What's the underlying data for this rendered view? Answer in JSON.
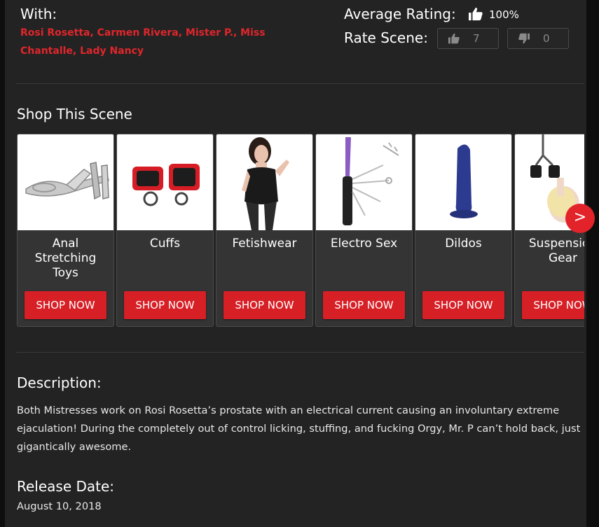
{
  "with": {
    "label": "With:",
    "cast": "Rosi Rosetta, Carmen Rivera, Mister P., Miss Chantalle, Lady Nancy"
  },
  "rating": {
    "average_label": "Average Rating:",
    "average_value": "100%",
    "rate_label": "Rate Scene:",
    "up_count": "7",
    "down_count": "0",
    "icons": {
      "average": "thumbs-up-icon",
      "up": "thumbs-up-icon",
      "down": "thumbs-down-icon"
    }
  },
  "shop": {
    "title": "Shop This Scene",
    "items": [
      {
        "name": "Anal Stretching Toys",
        "button": "SHOP NOW"
      },
      {
        "name": "Cuffs",
        "button": "SHOP NOW"
      },
      {
        "name": "Fetishwear",
        "button": "SHOP NOW"
      },
      {
        "name": "Electro Sex",
        "button": "SHOP NOW"
      },
      {
        "name": "Dildos",
        "button": "SHOP NOW"
      },
      {
        "name": "Suspension Gear",
        "button": "SHOP NOW"
      }
    ],
    "next_arrow": ">"
  },
  "description": {
    "title": "Description:",
    "text": "Both Mistresses work on Rosi Rosetta’s prostate with an electrical current causing an involuntary extreme ejaculation! During the completely out of control licking, stuffing, and fucking Orgy, Mr. P can’t hold back, just gigantically awesome."
  },
  "release": {
    "title": "Release Date:",
    "date": "August 10, 2018"
  },
  "colors": {
    "accent": "#e0262b",
    "button": "#d71f26",
    "panel": "#232323",
    "card": "#343434"
  }
}
